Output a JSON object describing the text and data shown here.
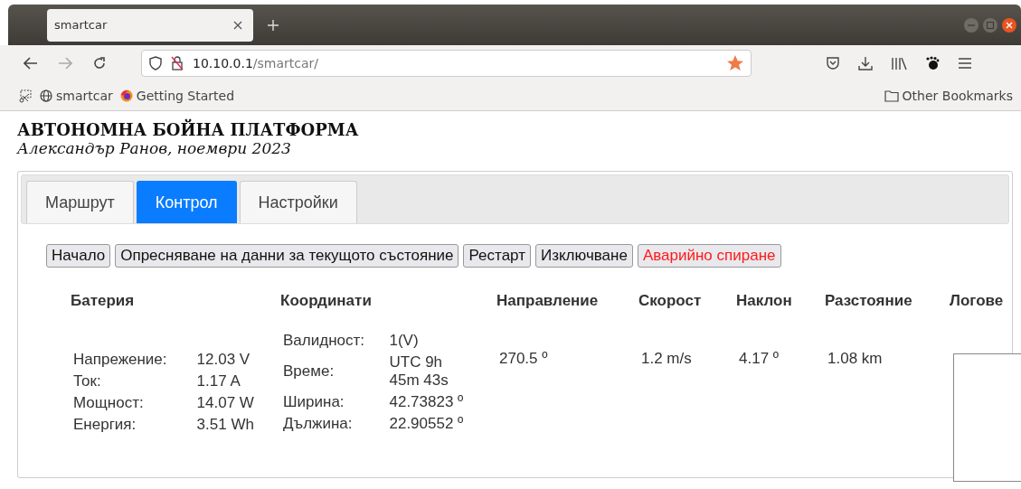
{
  "browser": {
    "tab_title": "smartcar",
    "url_host": "10.10.0.1",
    "url_path": "/smartcar/",
    "bookmarked": true,
    "bookmarks": [
      {
        "label": "smartcar",
        "kind": "globe"
      },
      {
        "label": "Getting Started",
        "kind": "firefox"
      }
    ],
    "other_bookmarks": "Other Bookmarks"
  },
  "page": {
    "title": "АВТОНОМНА БОЙНА ПЛАТФОРМА",
    "subtitle": "Александър Ранов, ноември 2023",
    "tabs": [
      {
        "label": "Маршрут",
        "selected": false
      },
      {
        "label": "Контрол",
        "selected": true
      },
      {
        "label": "Настройки",
        "selected": false
      }
    ],
    "buttons": [
      {
        "label": "Начало",
        "kind": "normal"
      },
      {
        "label": "Опресняване на данни за текущото състояние",
        "kind": "normal"
      },
      {
        "label": "Рестарт",
        "kind": "normal"
      },
      {
        "label": "Изключване",
        "kind": "normal"
      },
      {
        "label": "Аварийно спиране",
        "kind": "danger"
      }
    ],
    "columns": [
      "Батерия",
      "Координати",
      "Направление",
      "Скорост",
      "Наклон",
      "Разстояние",
      "Логове"
    ],
    "battery": [
      {
        "label": "Напрежение:",
        "value": "12.03 V"
      },
      {
        "label": "Ток:",
        "value": "1.17 A"
      },
      {
        "label": "Мощност:",
        "value": "14.07 W"
      },
      {
        "label": "Енергия:",
        "value": "3.51 Wh"
      }
    ],
    "coordinates": [
      {
        "label": "Валидност:",
        "value": "1(V)"
      },
      {
        "label": "Време:",
        "value": "UTC 9h 45m 43s"
      },
      {
        "label": "Ширина:",
        "value": "42.73823 º"
      },
      {
        "label": "Дължина:",
        "value": "22.90552 º"
      }
    ],
    "direction": "270.5 º",
    "speed": "1.2 m/s",
    "tilt": "4.17 º",
    "distance": "1.08 km"
  }
}
